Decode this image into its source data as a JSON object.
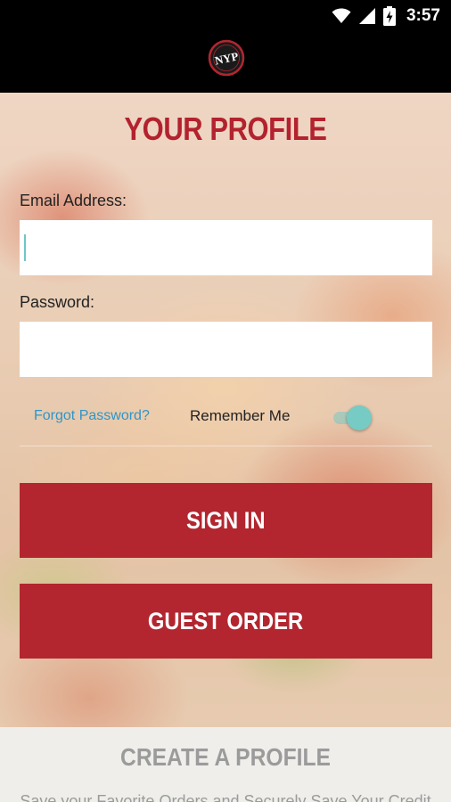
{
  "status_bar": {
    "time": "3:57",
    "icons": [
      "wifi-icon",
      "cell-signal-icon",
      "battery-charging-icon"
    ]
  },
  "header": {
    "logo_text": "NYP"
  },
  "profile": {
    "title": "YOUR PROFILE",
    "email_label": "Email Address:",
    "email_value": "",
    "password_label": "Password:",
    "password_value": "",
    "forgot_password": "Forgot Password?",
    "remember_me_label": "Remember Me",
    "remember_me_on": true,
    "sign_in_label": "SIGN IN",
    "guest_order_label": "GUEST ORDER"
  },
  "create_profile": {
    "title": "CREATE A PROFILE",
    "description": "Save your Favorite Orders and Securely Save Your Credit"
  },
  "colors": {
    "accent_red": "#b3262f",
    "title_red": "#b3222e",
    "link_blue": "#2d96c9",
    "toggle_teal": "#76cbc4"
  }
}
